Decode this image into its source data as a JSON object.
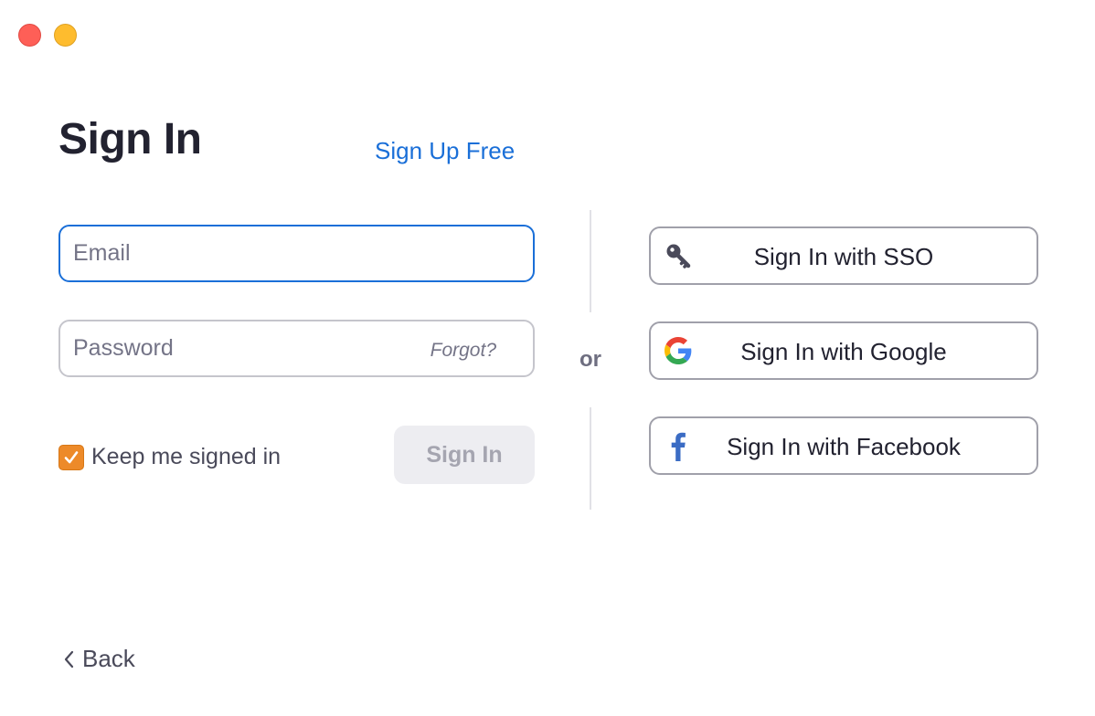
{
  "window": {
    "controls": [
      "close",
      "minimize"
    ]
  },
  "header": {
    "title": "Sign In",
    "signup_link": "Sign Up Free"
  },
  "form": {
    "email_placeholder": "Email",
    "email_value": "",
    "password_placeholder": "Password",
    "password_value": "",
    "forgot_label": "Forgot?",
    "keep_signed_in_label": "Keep me signed in",
    "keep_signed_in_checked": true,
    "submit_label": "Sign In"
  },
  "separator": {
    "label": "or"
  },
  "alt_signin": [
    {
      "icon": "key-icon",
      "label": "Sign In with SSO"
    },
    {
      "icon": "google-icon",
      "label": "Sign In with Google"
    },
    {
      "icon": "facebook-icon",
      "label": "Sign In with Facebook"
    }
  ],
  "footer": {
    "back_label": "Back"
  },
  "colors": {
    "accent": "#1a6fd8",
    "checkbox": "#ed8a29",
    "title": "#222230",
    "disabled_button_bg": "#ededf1"
  }
}
